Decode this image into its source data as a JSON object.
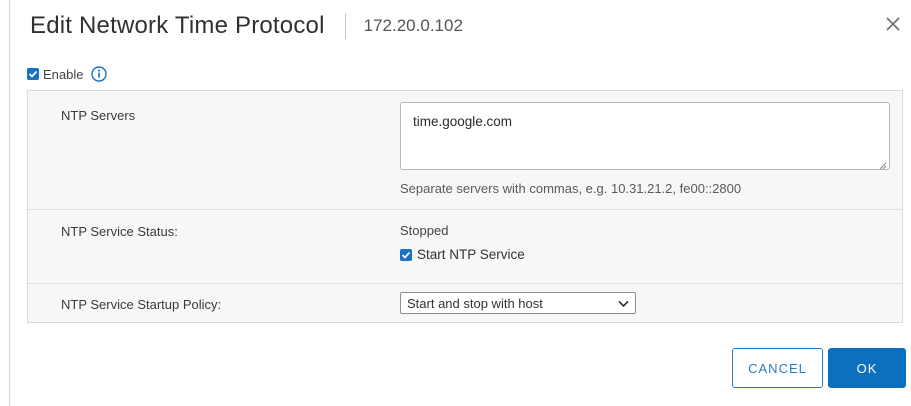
{
  "dialog": {
    "title": "Edit Network Time Protocol",
    "subtitle": "172.20.0.102"
  },
  "enable": {
    "label": "Enable",
    "checked": true
  },
  "rows": {
    "servers": {
      "label": "NTP Servers",
      "value": "time.google.com",
      "helper": "Separate servers with commas, e.g. 10.31.21.2, fe00::2800"
    },
    "status": {
      "label": "NTP Service Status:",
      "value": "Stopped",
      "start_label": "Start NTP Service",
      "start_checked": true
    },
    "policy": {
      "label": "NTP Service Startup Policy:",
      "selected": "Start and stop with host"
    }
  },
  "buttons": {
    "cancel": "CANCEL",
    "ok": "OK"
  },
  "colors": {
    "accent": "#0c70bf",
    "checkbox": "#1672c4"
  }
}
